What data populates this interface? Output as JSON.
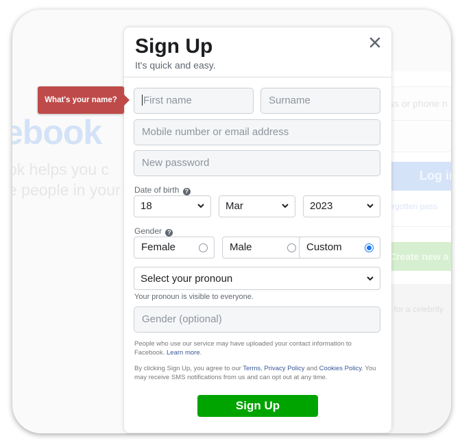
{
  "background": {
    "logo_fragment": "ebook",
    "tagline_line1": "ok helps you c",
    "tagline_line2": "e people in your",
    "login_input_placeholder": "ss or phone n",
    "login_button": "Log in",
    "forgot_link": "Forgotten pass",
    "create_button": "Create new a",
    "celebrity_text": "ge for a celebrity"
  },
  "modal": {
    "title": "Sign Up",
    "subtitle": "It's quick and easy.",
    "close_icon": "close-icon"
  },
  "tooltip": {
    "text": "What's your name?"
  },
  "form": {
    "first_name": {
      "placeholder": "First name",
      "value": ""
    },
    "surname": {
      "placeholder": "Surname",
      "value": ""
    },
    "mobile": {
      "placeholder": "Mobile number or email address",
      "value": ""
    },
    "password": {
      "placeholder": "New password",
      "value": ""
    },
    "dob": {
      "label": "Date of birth",
      "day": "18",
      "month": "Mar",
      "year": "2023"
    },
    "gender": {
      "label": "Gender",
      "options": [
        {
          "label": "Female",
          "checked": false
        },
        {
          "label": "Male",
          "checked": false
        },
        {
          "label": "Custom",
          "checked": true
        }
      ]
    },
    "pronoun": {
      "selected": "Select your pronoun",
      "note": "Your pronoun is visible to everyone."
    },
    "gender_optional": {
      "placeholder": "Gender (optional)",
      "value": ""
    }
  },
  "legal": {
    "p1_text": "People who use our service may have uploaded your contact information to Facebook.",
    "p1_link": "Learn more",
    "p2_prefix": "By clicking Sign Up, you agree to our",
    "terms_link": "Terms",
    "privacy_link": "Privacy Policy",
    "and_text": "and",
    "cookies_link": "Cookies Policy",
    "p2_suffix": "You may receive SMS notifications from us and can opt out at any time."
  },
  "signup_button": "Sign Up",
  "colors": {
    "signup_green": "#00a400",
    "tooltip_red": "#be4b49",
    "link_blue": "#385898",
    "radio_blue": "#1877f2"
  }
}
